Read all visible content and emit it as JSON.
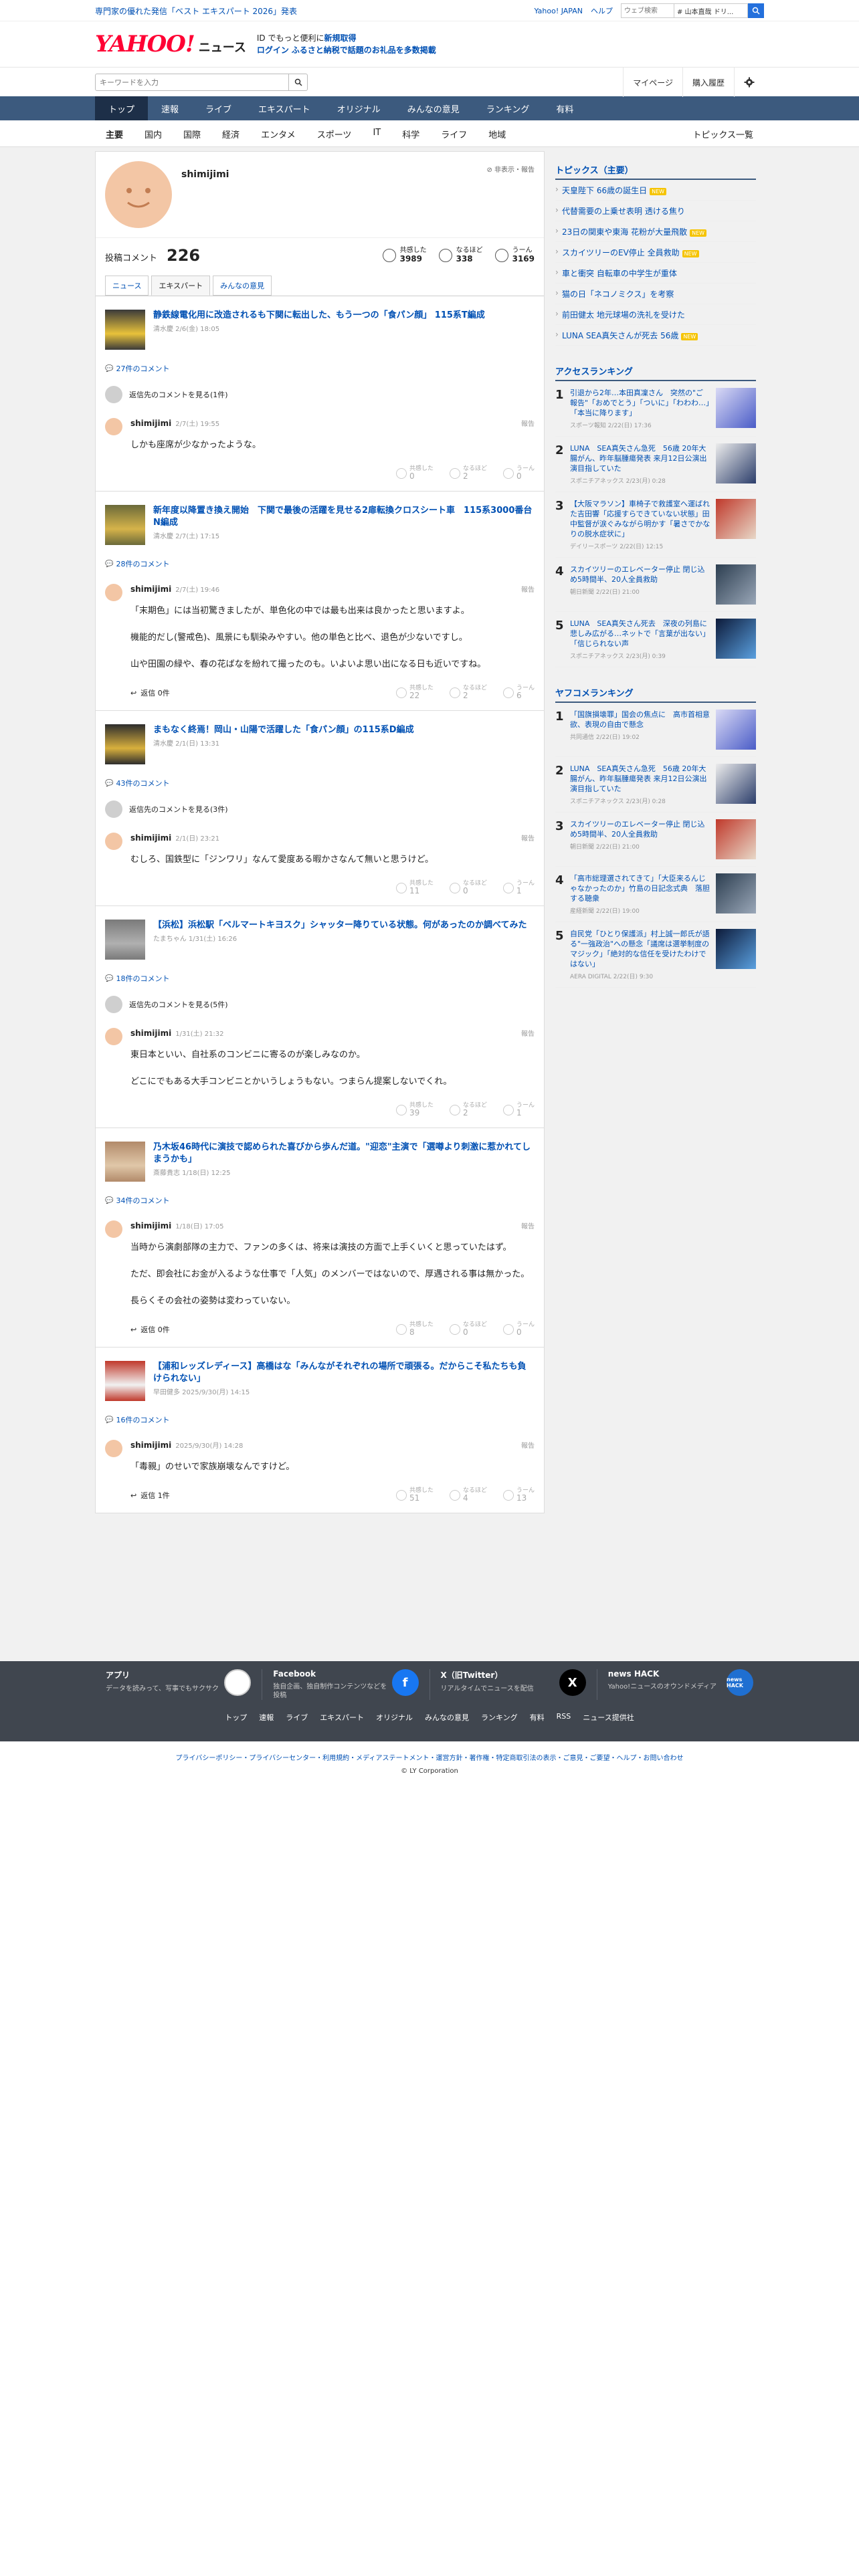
{
  "top": {
    "promo": "専門家の優れた発信「ベスト エキスパート 2026」発表",
    "yahoo_japan": "Yahoo! JAPAN",
    "help": "ヘルプ",
    "web_search_placeholder": "ウェブ検索",
    "web_search_hint": "# 山本直哉 ドリ..."
  },
  "header": {
    "logo": "YAHOO!",
    "logo_sub": "JAPAN",
    "logo_news": "ニュース",
    "msg1_pre": "ID でもっと便利に",
    "msg1_link": "新規取得",
    "msg2_login": "ログイン",
    "msg2_rest": "ふるさと納税で話題のお礼品を多数掲載"
  },
  "search": {
    "placeholder": "キーワードを入力",
    "mypage": "マイページ",
    "history": "購入履歴"
  },
  "nav": {
    "items": [
      "トップ",
      "速報",
      "ライブ",
      "エキスパート",
      "オリジナル",
      "みんなの意見",
      "ランキング",
      "有料"
    ]
  },
  "subnav": {
    "items": [
      "主要",
      "国内",
      "国際",
      "経済",
      "エンタメ",
      "スポーツ",
      "IT",
      "科学",
      "ライフ",
      "地域"
    ],
    "all_topics": "トピックス一覧"
  },
  "profile": {
    "name": "shimijimi",
    "report": "非表示・報告",
    "posted_label": "投稿コメント",
    "posted_count": "226",
    "reactions": [
      {
        "label": "共感した",
        "value": "3989"
      },
      {
        "label": "なるほど",
        "value": "338"
      },
      {
        "label": "うーん",
        "value": "3169"
      }
    ]
  },
  "tabs": [
    "ニュース",
    "エキスパート",
    "みんなの意見"
  ],
  "articles": [
    {
      "title": "静鉄線電化用に改造されるも下関に転出した、もう一つの「食パン顔」 115系T編成",
      "meta": "清水慶 2/6(金) 18:05",
      "comment_count": "27件のコメント",
      "parent": "返信先のコメントを見る(1件)",
      "user": "shimijimi",
      "date": "2/7(土) 19:55",
      "report": "報告",
      "text": [
        "しかも座席が少なかったような。"
      ],
      "reply": "",
      "reacts": [
        "0",
        "2",
        "0"
      ]
    },
    {
      "title": "新年度以降置き換え開始　下関で最後の活躍を見せる2扉転換クロスシート車　115系3000番台N編成",
      "meta": "清水慶 2/7(土) 17:15",
      "comment_count": "28件のコメント",
      "parent": "",
      "user": "shimijimi",
      "date": "2/7(土) 19:46",
      "report": "報告",
      "text": [
        "「末期色」には当初驚きましたが、単色化の中では最も出来は良かったと思いますよ。",
        "機能的だし(警戒色)、風景にも馴染みやすい。他の単色と比べ、退色が少ないですし。",
        "山や田園の緑や、春の花ばなを紛れて撮ったのも。いよいよ思い出になる日も近いですね。"
      ],
      "reply": "返信 0件",
      "reacts": [
        "22",
        "2",
        "6"
      ]
    },
    {
      "title": "まもなく終焉！岡山・山陽で活躍した「食パン顔」の115系D編成",
      "meta": "清水慶 2/1(日) 13:31",
      "comment_count": "43件のコメント",
      "parent": "返信先のコメントを見る(3件)",
      "user": "shimijimi",
      "date": "2/1(日) 23:21",
      "report": "報告",
      "text": [
        "むしろ、国鉄型に「ジンワリ」なんて愛度ある暇かさなんて無いと思うけど。"
      ],
      "reply": "",
      "reacts": [
        "11",
        "0",
        "1"
      ]
    },
    {
      "title": "【浜松】浜松駅「ベルマートキヨスク」シャッター降りている状態。何があったのか調べてみた",
      "meta": "たまちゃん 1/31(土) 16:26",
      "comment_count": "18件のコメント",
      "parent": "返信先のコメントを見る(5件)",
      "user": "shimijimi",
      "date": "1/31(土) 21:32",
      "report": "報告",
      "text": [
        "東日本といい、自社系のコンビニに寄るのが楽しみなのか。",
        "どこにでもある大手コンビニとかいうしょうもない。つまらん提案しないでくれ。"
      ],
      "reply": "",
      "reacts": [
        "39",
        "2",
        "1"
      ]
    },
    {
      "title": "乃木坂46時代に演技で認められた喜びから歩んだ道。\"迎恋\"主演で「選噂より刺激に惹かれてしまうかも」",
      "meta": "斎藤貴志 1/18(日) 12:25",
      "comment_count": "34件のコメント",
      "parent": "",
      "user": "shimijimi",
      "date": "1/18(日) 17:05",
      "report": "報告",
      "text": [
        "当時から演劇部隊の主力で、ファンの多くは、将来は演技の方面で上手くいくと思っていたはず。",
        "ただ、即会社にお金が入るような仕事で「人気」のメンバーではないので、厚遇される事は無かった。",
        "長らくその会社の姿勢は変わっていない。"
      ],
      "reply": "返信 0件",
      "reacts": [
        "8",
        "0",
        "0"
      ]
    },
    {
      "title": "【浦和レッズレディース】高橋はな「みんながそれぞれの場所で頑張る。だからこそ私たちも負けられない」",
      "meta": "早田健多 2025/9/30(月) 14:15",
      "comment_count": "16件のコメント",
      "parent": "",
      "user": "shimijimi",
      "date": "2025/9/30(月) 14:28",
      "report": "報告",
      "text": [
        "「毒親」のせいで家族崩壊なんですけど。"
      ],
      "reply": "返信 1件",
      "reacts": [
        "51",
        "4",
        "13"
      ]
    }
  ],
  "sidebar": {
    "topics_title": "トピックス（主要）",
    "topics": [
      {
        "text": "天皇陛下 66歳の誕生日",
        "new": true
      },
      {
        "text": "代替需要の上乗せ表明 透ける焦り",
        "new": false
      },
      {
        "text": "23日の関東や東海 花粉が大量飛散",
        "new": true
      },
      {
        "text": "スカイツリーのEV停止 全員救助",
        "new": true
      },
      {
        "text": "車と衝突 自転車の中学生が重体",
        "new": false
      },
      {
        "text": "猫の日「ネコノミクス」を考察",
        "new": false
      },
      {
        "text": "前田健太 地元球場の洗礼を受けた",
        "new": false
      },
      {
        "text": "LUNA SEA真矢さんが死去 56歳",
        "new": true
      }
    ],
    "access_title": "アクセスランキング",
    "access": [
      {
        "text": "引退から2年…本田真凜さん　突然の\"ご報告\"「おめでとう」「ついに」「わわわ…」「本当に降ります」",
        "meta": "スポーツ報知 2/22(日) 17:36"
      },
      {
        "text": "LUNA　SEA真矢さん急死　56歳 20年大腸がん、昨年脳腫瘍発表 来月12日公演出演目指していた",
        "meta": "スポニチアネックス 2/23(月) 0:28"
      },
      {
        "text": "【大阪マラソン】車椅子で救護室へ運ばれた吉田響「応援すらできていない状態」田中監督が涙ぐみながら明かす「暑さでかなりの脱水症状に」",
        "meta": "デイリースポーツ 2/22(日) 12:15"
      },
      {
        "text": "スカイツリーのエレベーター停止 閉じ込め5時間半、20人全員救助",
        "meta": "朝日新聞 2/22(日) 21:00"
      },
      {
        "text": "LUNA　SEA真矢さん死去　深夜の列島に悲しみ広がる…ネットで「言葉が出ない」「信じられない声",
        "meta": "スポニチアネックス 2/23(月) 0:39"
      }
    ],
    "yahoo_title": "ヤフコメランキング",
    "yahoo": [
      {
        "text": "「国旗損壊罪」国会の焦点に　高市首相意欲、表現の自由で懸念",
        "meta": "共同通信 2/22(日) 19:02"
      },
      {
        "text": "LUNA　SEA真矢さん急死　56歳 20年大腸がん、昨年脳腫瘍発表 来月12日公演出演目指していた",
        "meta": "スポニチアネックス 2/23(月) 0:28"
      },
      {
        "text": "スカイツリーのエレベーター停止 閉じ込め5時間半、20人全員救助",
        "meta": "朝日新聞 2/22(日) 21:00"
      },
      {
        "text": "「高市総理選されてきて」「大臣来るんじゃなかったのか」竹島の日記念式典　落胆する聴衆",
        "meta": "産経新聞 2/22(日) 19:00"
      },
      {
        "text": "自民党「ひとり保護派」村上誠一郎氏が語る\"一強政治\"への懸念「議席は選挙制度のマジック」「絶対的な信任を受けたわけではない」",
        "meta": "AERA DIGITAL 2/22(日) 9:30"
      }
    ]
  },
  "footer": {
    "cards": [
      {
        "title": "アプリ",
        "desc": "データを読みって、写事でもサクサク",
        "icon": "app"
      },
      {
        "title": "Facebook",
        "desc": "独自企画、独自制作コンテンツなどを投稿",
        "icon": "f"
      },
      {
        "title": "X（旧Twitter）",
        "desc": "リアルタイムでニュースを配信",
        "icon": "X"
      },
      {
        "title": "news HACK",
        "desc": "Yahoo!ニュースのオウンドメディア",
        "icon": "news HACK"
      }
    ],
    "links": [
      "トップ",
      "速報",
      "ライブ",
      "エキスパート",
      "オリジナル",
      "みんなの意見",
      "ランキング",
      "有料",
      "RSS",
      "ニュース提供社"
    ],
    "legal": "プライバシーポリシー・プライバシーセンター・利用規約・メディアステートメント・運営方針・著作権・特定商取引法の表示・ご意見・ご要望・ヘルプ・お問い合わせ",
    "copyright": "© LY Corporation"
  }
}
